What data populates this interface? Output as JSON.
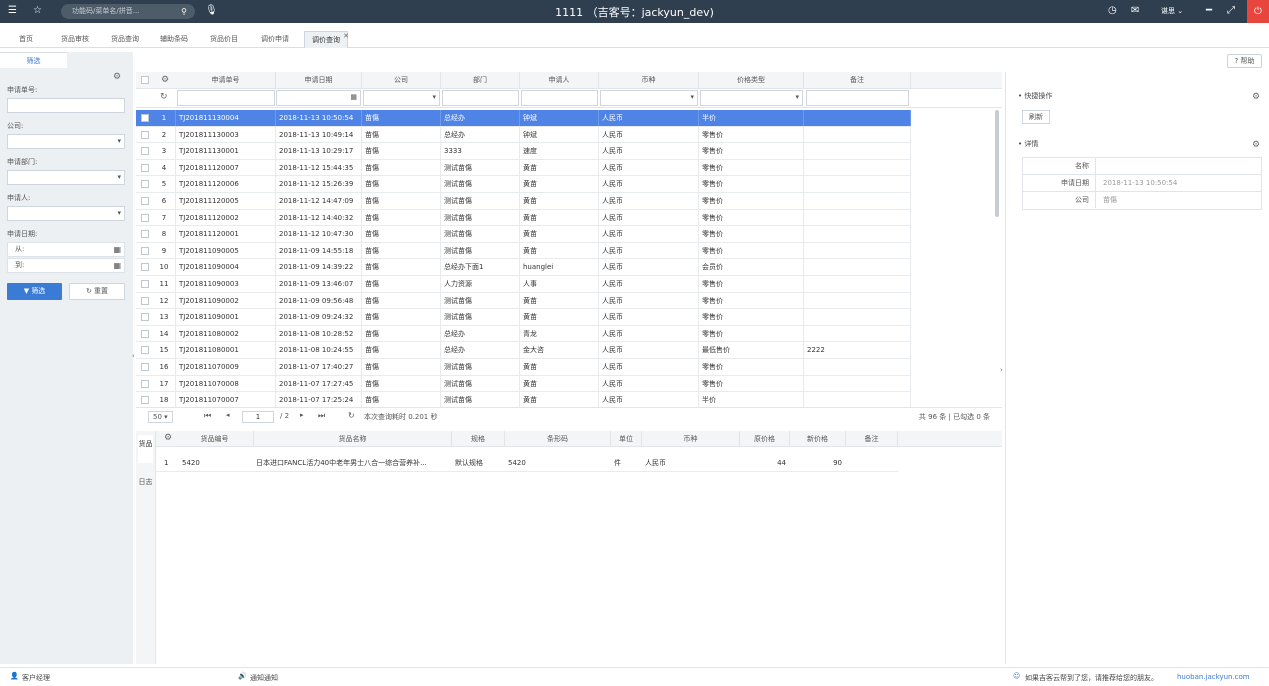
{
  "topbar": {
    "search_placeholder": "功能码/菜单名/拼音...",
    "title": "1111 （吉客号：jackyun_dev)",
    "user": "谌思"
  },
  "tabs": [
    {
      "label": "首页"
    },
    {
      "label": "货品审核"
    },
    {
      "label": "货品查询"
    },
    {
      "label": "辅助条码"
    },
    {
      "label": "货品价目"
    },
    {
      "label": "调价申请"
    },
    {
      "label": "调价查询"
    }
  ],
  "help_label": "帮助",
  "sidebar": {
    "tab_label": "筛选",
    "apply_no_label": "申请单号:",
    "company_label": "公司:",
    "dept_label": "申请部门:",
    "applicant_label": "申请人:",
    "date_label": "申请日期:",
    "from_label": "从:",
    "to_label": "到:",
    "filter_btn": "筛选",
    "reset_btn": "重置"
  },
  "grid": {
    "columns": [
      "申请单号",
      "申请日期",
      "公司",
      "部门",
      "申请人",
      "币种",
      "价格类型",
      "备注"
    ],
    "rows": [
      [
        "1",
        "TJ201811130004",
        "2018-11-13 10:50:54",
        "苗傷",
        "总经办",
        "钟斌",
        "人民币",
        "半价",
        ""
      ],
      [
        "2",
        "TJ201811130003",
        "2018-11-13 10:49:14",
        "苗傷",
        "总经办",
        "钟斌",
        "人民币",
        "零售价",
        ""
      ],
      [
        "3",
        "TJ201811130001",
        "2018-11-13 10:29:17",
        "苗傷",
        "3333",
        "速度",
        "人民币",
        "零售价",
        ""
      ],
      [
        "4",
        "TJ201811120007",
        "2018-11-12 15:44:35",
        "苗傷",
        "测试苗傷",
        "黄苗",
        "人民币",
        "零售价",
        ""
      ],
      [
        "5",
        "TJ201811120006",
        "2018-11-12 15:26:39",
        "苗傷",
        "测试苗傷",
        "黄苗",
        "人民币",
        "零售价",
        ""
      ],
      [
        "6",
        "TJ201811120005",
        "2018-11-12 14:47:09",
        "苗傷",
        "测试苗傷",
        "黄苗",
        "人民币",
        "零售价",
        ""
      ],
      [
        "7",
        "TJ201811120002",
        "2018-11-12 14:40:32",
        "苗傷",
        "测试苗傷",
        "黄苗",
        "人民币",
        "零售价",
        ""
      ],
      [
        "8",
        "TJ201811120001",
        "2018-11-12 10:47:30",
        "苗傷",
        "测试苗傷",
        "黄苗",
        "人民币",
        "零售价",
        ""
      ],
      [
        "9",
        "TJ201811090005",
        "2018-11-09 14:55:18",
        "苗傷",
        "测试苗傷",
        "黄苗",
        "人民币",
        "零售价",
        ""
      ],
      [
        "10",
        "TJ201811090004",
        "2018-11-09 14:39:22",
        "苗傷",
        "总经办下面1",
        "huanglei",
        "人民币",
        "会员价",
        ""
      ],
      [
        "11",
        "TJ201811090003",
        "2018-11-09 13:46:07",
        "苗傷",
        "人力资源",
        "人事",
        "人民币",
        "零售价",
        ""
      ],
      [
        "12",
        "TJ201811090002",
        "2018-11-09 09:56:48",
        "苗傷",
        "测试苗傷",
        "黄苗",
        "人民币",
        "零售价",
        ""
      ],
      [
        "13",
        "TJ201811090001",
        "2018-11-09 09:24:32",
        "苗傷",
        "测试苗傷",
        "黄苗",
        "人民币",
        "零售价",
        ""
      ],
      [
        "14",
        "TJ201811080002",
        "2018-11-08 10:28:52",
        "苗傷",
        "总经办",
        "青龙",
        "人民币",
        "零售价",
        ""
      ],
      [
        "15",
        "TJ201811080001",
        "2018-11-08 10:24:55",
        "苗傷",
        "总经办",
        "金大咨",
        "人民币",
        "最低售价",
        "2222"
      ],
      [
        "16",
        "TJ201811070009",
        "2018-11-07 17:40:27",
        "苗傷",
        "测试苗傷",
        "黄苗",
        "人民币",
        "零售价",
        ""
      ],
      [
        "17",
        "TJ201811070008",
        "2018-11-07 17:27:45",
        "苗傷",
        "测试苗傷",
        "黄苗",
        "人民币",
        "零售价",
        ""
      ],
      [
        "18",
        "TJ201811070007",
        "2018-11-07 17:25:24",
        "苗傷",
        "测试苗傷",
        "黄苗",
        "人民币",
        "半价",
        ""
      ]
    ]
  },
  "pager": {
    "page_size": "50",
    "page": "1",
    "total_pages": "/ 2",
    "query_time": "本次查询耗时 0.201 秒",
    "summary": "共 96 条 | 已勾选 0 条"
  },
  "detail": {
    "vtab_goods": "货品",
    "vtab_log": "日志",
    "columns": [
      "货品编号",
      "货品名称",
      "规格",
      "条形码",
      "单位",
      "币种",
      "原价格",
      "新价格",
      "备注"
    ],
    "row": [
      "1",
      "5420",
      "日本进口FANCL活力40中老年男士八合一综合营养补...",
      "默认规格",
      "5420",
      "件",
      "人民币",
      "44",
      "90",
      ""
    ]
  },
  "right": {
    "quick_title": "快捷操作",
    "refresh_btn": "刷新",
    "detail_title": "详情",
    "name_label": "名称",
    "name_value": "",
    "date_label": "申请日期",
    "date_value": "2018-11-13 10:50:54",
    "company_label": "公司",
    "company_value": "苗傷"
  },
  "status": {
    "manager": "客户经理",
    "notice": "通知通知",
    "promo": "如果吉客云帮到了您，请推荐给您的朋友。",
    "link": "huoban.jackyun.com"
  },
  "colors": {
    "topbar": "#2f3f50",
    "accent": "#3a7bd5",
    "selected_row": "#4f84e6",
    "power": "#e8453c"
  }
}
